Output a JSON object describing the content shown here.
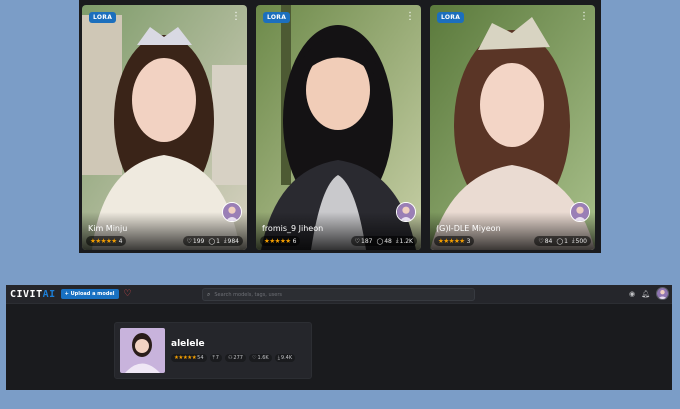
{
  "cards": [
    {
      "badge": "LORA",
      "name": "Kim Minju",
      "rating": "4",
      "likes": "199",
      "comments": "1",
      "downloads": "984",
      "palette": {
        "bg1": "#8fae7a",
        "bg2": "#d9d4c6",
        "hair": "#3a2418",
        "dress": "#efeadf",
        "skin": "#f2d2c2"
      }
    },
    {
      "badge": "LORA",
      "name": "fromis_9 Jiheon",
      "rating": "6",
      "likes": "187",
      "comments": "48",
      "downloads": "1.2K",
      "palette": {
        "bg1": "#6d8a4a",
        "bg2": "#c7cfa6",
        "hair": "#141214",
        "dress": "#2a2a30",
        "skin": "#f1cdb8"
      }
    },
    {
      "badge": "LORA",
      "name": "(G)I-DLE Miyeon",
      "rating": "3",
      "likes": "84",
      "comments": "1",
      "downloads": "500",
      "palette": {
        "bg1": "#5b7a3c",
        "bg2": "#a9c08b",
        "hair": "#5a3526",
        "dress": "#eadbd2",
        "skin": "#f3d5c6"
      }
    }
  ],
  "app": {
    "logo_main": "CIVIT",
    "logo_accent": "AI",
    "upload_label": "+ Upload a model",
    "search_placeholder": "Search models, tags, users"
  },
  "creator": {
    "name": "alelele",
    "rating": "54",
    "uploads": "7",
    "followers": "277",
    "likes": "1.6K",
    "downloads": "9.4K"
  },
  "colors": {
    "accent": "#1c7ed6",
    "star": "#f59f00",
    "background": "#7b9dc7"
  }
}
